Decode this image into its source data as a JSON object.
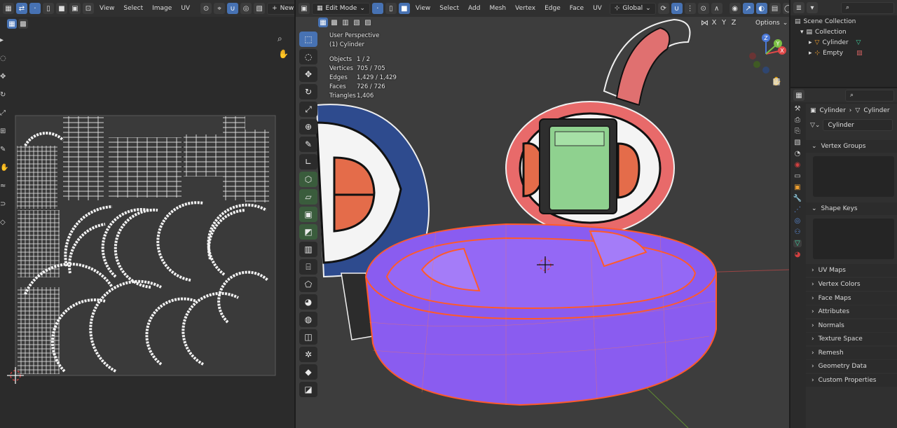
{
  "uv_editor": {
    "menu": [
      "View",
      "Select",
      "Image",
      "UV"
    ],
    "new_label": "New"
  },
  "viewport": {
    "mode": "Edit Mode",
    "menu": [
      "View",
      "Select",
      "Add",
      "Mesh",
      "Vertex",
      "Edge",
      "Face",
      "UV"
    ],
    "orientation": "Global",
    "options_label": "Options",
    "axis_x": "X",
    "axis_y": "Y",
    "axis_z": "Z",
    "view_name": "User Perspective",
    "object_name": "(1) Cylinder",
    "stats": [
      {
        "label": "Objects",
        "value": "1 / 2"
      },
      {
        "label": "Vertices",
        "value": "705 / 705"
      },
      {
        "label": "Edges",
        "value": "1,429 / 1,429"
      },
      {
        "label": "Faces",
        "value": "726 / 726"
      },
      {
        "label": "Triangles",
        "value": "1,406"
      }
    ],
    "gizmo": {
      "x": "X",
      "y": "Y",
      "z": "Z"
    }
  },
  "outliner": {
    "scene_collection": "Scene Collection",
    "collection": "Collection",
    "items": [
      "Cylinder",
      "Empty"
    ]
  },
  "properties": {
    "breadcrumb_object": "Cylinder",
    "breadcrumb_data": "Cylinder",
    "mesh_name": "Cylinder",
    "panels": [
      "Vertex Groups",
      "Shape Keys",
      "UV Maps",
      "Vertex Colors",
      "Face Maps",
      "Attributes",
      "Normals",
      "Texture Space",
      "Remesh",
      "Geometry Data",
      "Custom Properties"
    ]
  },
  "colors": {
    "accent": "#4772b3",
    "selection": "#8a5cf0",
    "edge": "#ff5a2a",
    "header": "#303030",
    "viewport": "#3c3c3c"
  }
}
